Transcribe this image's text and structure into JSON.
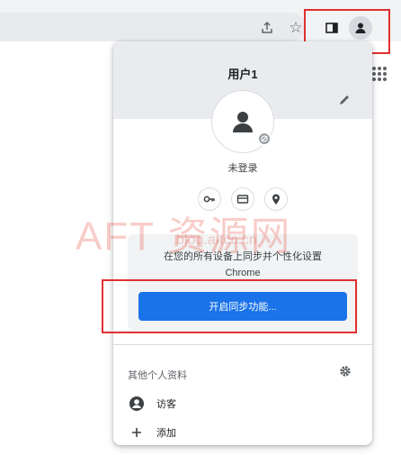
{
  "toolbar": {
    "icons": [
      "share-icon",
      "star-icon",
      "side-panel-icon",
      "profile-icon",
      "apps-icon"
    ]
  },
  "profile": {
    "name": "用户1",
    "status": "未登录"
  },
  "quick_links": [
    "key-icon",
    "card-icon",
    "location-icon"
  ],
  "sync": {
    "description_line1": "在您的所有设备上同步并个性化设置",
    "description_line2": "Chrome",
    "button_label": "开启同步功能..."
  },
  "other": {
    "title": "其他个人资料",
    "guest_label": "访客",
    "add_label": "添加"
  },
  "watermark": {
    "big": "AFT 资源网",
    "small": "blog.aftcc.cn"
  },
  "colors": {
    "accent": "#1a73e8",
    "highlight": "#e0302f",
    "header_bg": "#e9ebee"
  }
}
